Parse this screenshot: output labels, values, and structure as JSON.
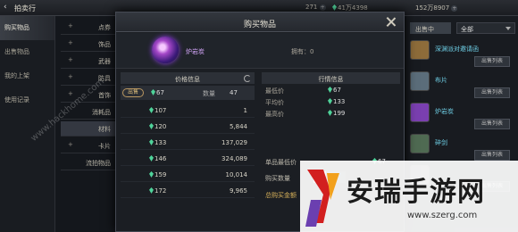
{
  "topbar": {
    "back": "‹",
    "title": "拍卖行",
    "res1": "271",
    "res2": "41万4398",
    "res3": "152万8907"
  },
  "sidenav": [
    "购买物品",
    "出售物品",
    "我的上架",
    "使用记录"
  ],
  "categories": [
    {
      "label": "点券",
      "plus": true
    },
    {
      "label": "饰品",
      "plus": true
    },
    {
      "label": "武器",
      "plus": true
    },
    {
      "label": "防具",
      "plus": true
    },
    {
      "label": "首饰",
      "plus": true
    },
    {
      "label": "消耗品",
      "plus": false
    },
    {
      "label": "材料",
      "plus": false,
      "selected": true
    },
    {
      "label": "卡片",
      "plus": true
    },
    {
      "label": "流拍物品",
      "plus": false
    }
  ],
  "right": {
    "tab": "出售中",
    "filter": "全部",
    "items": [
      {
        "name": "深渊派对邀请函",
        "button": "出售列表",
        "color": "#8d6c3a"
      },
      {
        "name": "布片",
        "button": "出售列表",
        "color": "#5b6d7a"
      },
      {
        "name": "炉岩炭",
        "button": "出售列表",
        "color": "#7a3fb0"
      },
      {
        "name": "碎剑",
        "button": "出售列表",
        "color": "#4f6a52"
      },
      {
        "name": "",
        "button": "出售列表",
        "color": "#4a4a55"
      }
    ]
  },
  "modal": {
    "title": "购买物品",
    "item_name": "炉岩炭",
    "owned": "拥有：0",
    "price_header": "价格信息",
    "market_header": "行情信息",
    "sale_tag": "出售",
    "selected_price": "67",
    "qty_label": "数量",
    "selected_qty": "47",
    "rows": [
      {
        "price": "107",
        "qty": "1"
      },
      {
        "price": "120",
        "qty": "5,844"
      },
      {
        "price": "133",
        "qty": "137,029"
      },
      {
        "price": "146",
        "qty": "324,089"
      },
      {
        "price": "159",
        "qty": "10,014"
      },
      {
        "price": "172",
        "qty": "9,965"
      }
    ],
    "market": [
      {
        "k": "最低价",
        "v": "67"
      },
      {
        "k": "平均价",
        "v": "133"
      },
      {
        "k": "最高价",
        "v": "199"
      }
    ],
    "unit_low_label": "单品最低价",
    "unit_low_value": "67",
    "buy_qty_label": "购买数量",
    "total_label": "总购买金额",
    "qty_minus": "−"
  },
  "watermark": {
    "hack": "www.hackhome.com",
    "title": "安瑞手游网",
    "url": "www.szerg.com"
  },
  "colors": {
    "gem": "#4fd39a",
    "gold": "#d8b25a",
    "item_name": "#d8a9ff"
  }
}
